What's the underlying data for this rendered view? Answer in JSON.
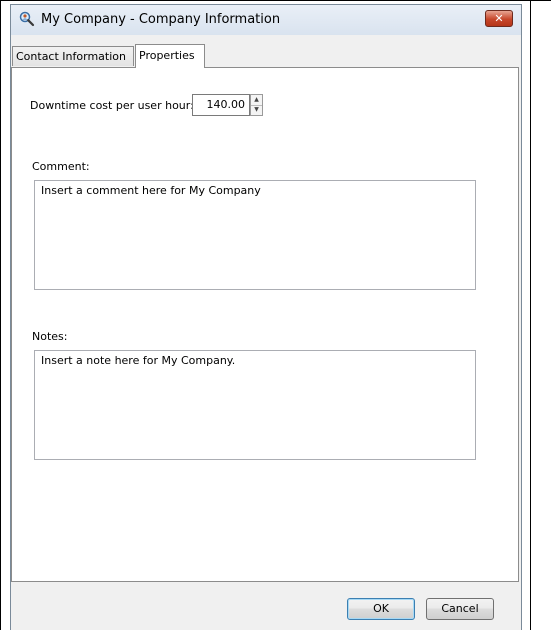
{
  "window": {
    "title": "My Company - Company Information",
    "close_glyph": "✕"
  },
  "tabs": [
    {
      "label": "Contact Information",
      "selected": false
    },
    {
      "label": "Properties",
      "selected": true
    }
  ],
  "properties": {
    "downtime_label": "Downtime cost per user hour:",
    "downtime_value": "140.00",
    "comment_label": "Comment:",
    "comment_text": "Insert a comment here for My Company",
    "notes_label": "Notes:",
    "notes_text": "Insert a note here for My Company."
  },
  "buttons": {
    "ok_label": "OK",
    "cancel_label": "Cancel"
  },
  "icons": {
    "app": "magnifier-person-icon",
    "close": "close-icon",
    "spin_up": "spin-up-icon",
    "spin_down": "spin-down-icon"
  },
  "colors": {
    "close_button": "#c7472b",
    "window_bg": "#f0f0f0",
    "ok_button_border": "#3c7fb1"
  }
}
